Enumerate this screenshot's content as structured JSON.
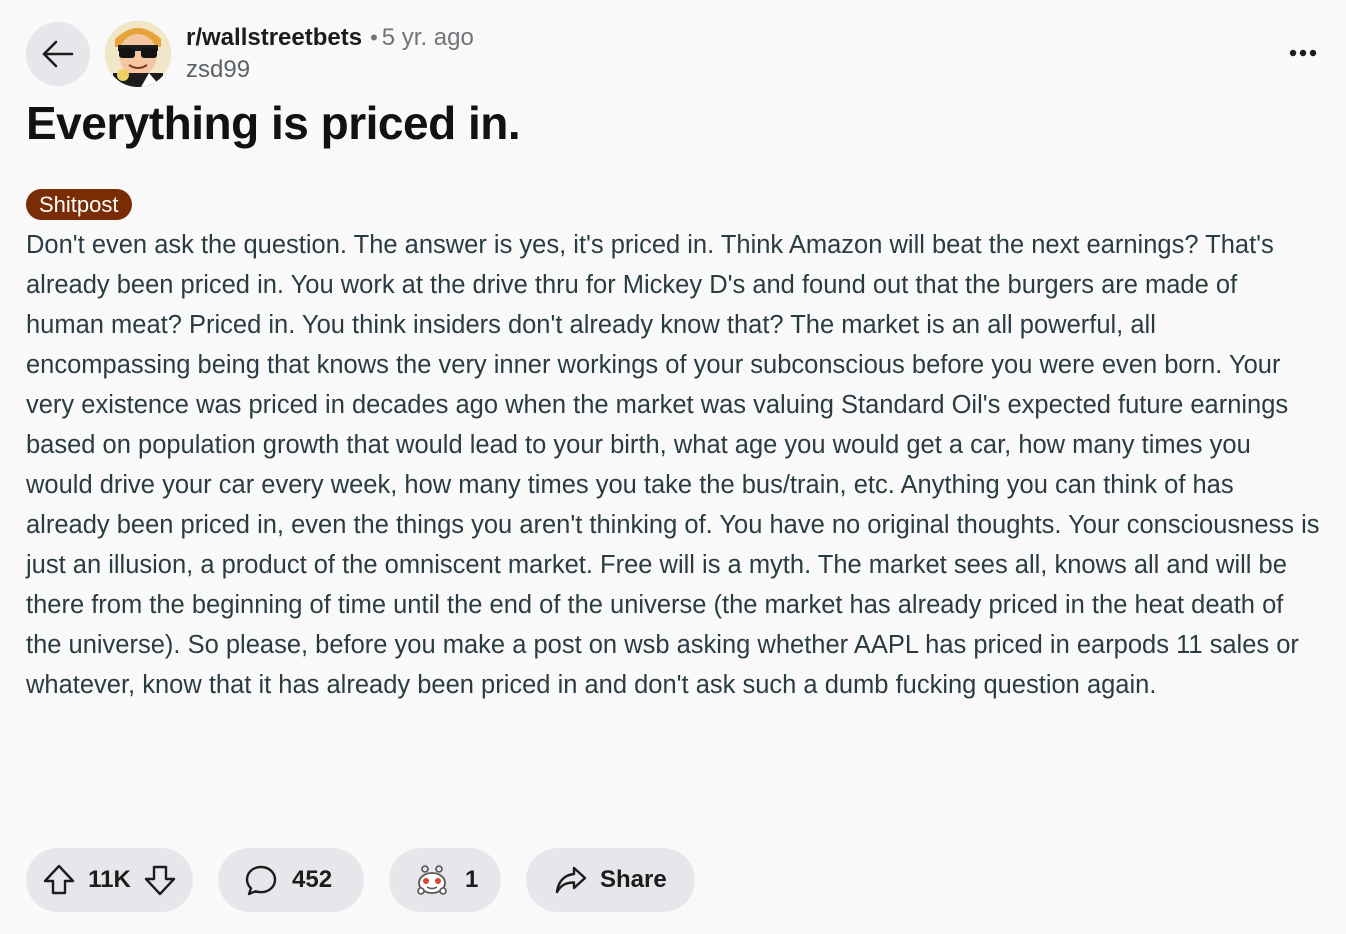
{
  "header": {
    "subreddit": "r/wallstreetbets",
    "separator": "•",
    "age": "5 yr. ago",
    "author": "zsd99"
  },
  "post": {
    "title": "Everything is priced in.",
    "flair": "Shitpost",
    "flair_color": "#7a2c04",
    "body": "Don't even ask the question. The answer is yes, it's priced in. Think Amazon will beat the next earnings? That's already been priced in. You work at the drive thru for Mickey D's and found out that the burgers are made of human meat? Priced in. You think insiders don't already know that? The market is an all powerful, all encompassing being that knows the very inner workings of your subconscious before you were even born. Your very existence was priced in decades ago when the market was valuing Standard Oil's expected future earnings based on population growth that would lead to your birth, what age you would get a car, how many times you would drive your car every week, how many times you take the bus/train, etc. Anything you can think of has already been priced in, even the things you aren't thinking of. You have no original thoughts. Your consciousness is just an illusion, a product of the omniscent market. Free will is a myth. The market sees all, knows all and will be there from the beginning of time until the end of the universe (the market has already priced in the heat death of the universe). So please, before you make a post on wsb asking whether AAPL has priced in earpods 11 sales or whatever, know that it has already been priced in and don't ask such a dumb fucking question again."
  },
  "actions": {
    "votes": "11K",
    "comments": "452",
    "awards": "1",
    "share_label": "Share"
  },
  "icons": {
    "back": "arrow-left-icon",
    "more": "more-horizontal-icon",
    "upvote": "upvote-arrow-icon",
    "downvote": "downvote-arrow-icon",
    "comment": "speech-bubble-icon",
    "award": "award-icon",
    "share": "share-arrow-icon"
  },
  "colors": {
    "background": "#f9f9f9",
    "pill": "#e5e7ea",
    "body_text": "#2a3c42"
  }
}
